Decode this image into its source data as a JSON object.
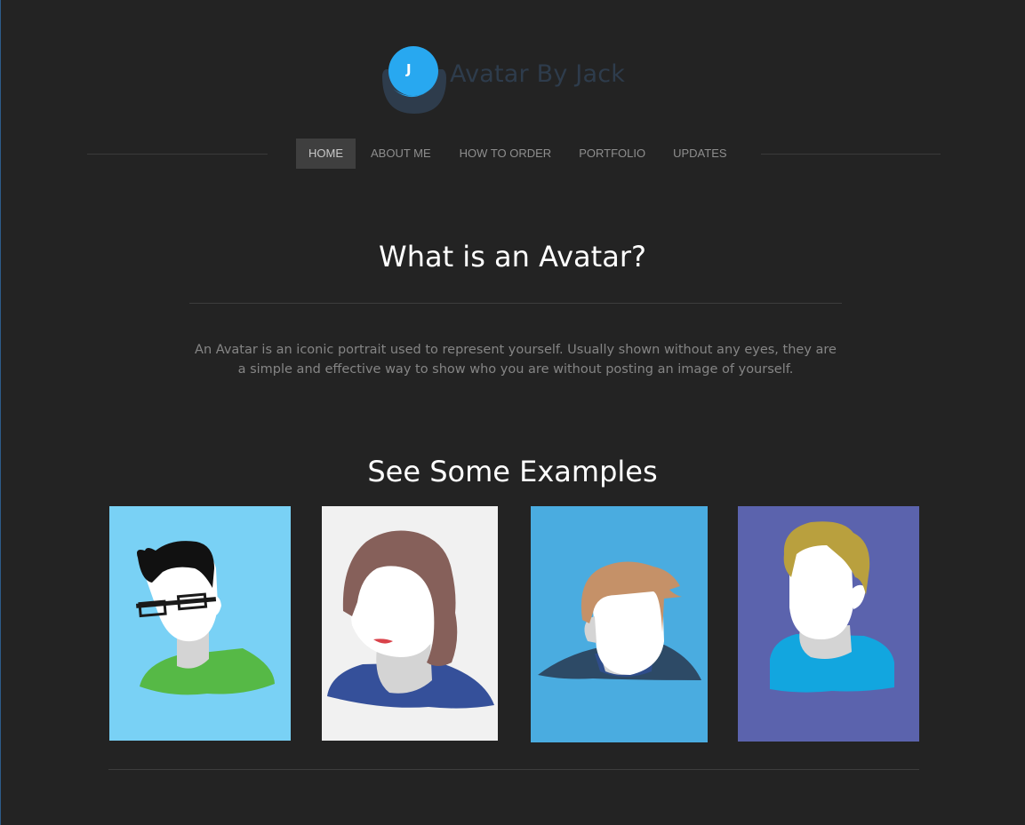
{
  "brand": {
    "logo_letter": "J",
    "name": "Avatar By Jack",
    "logo_color": "#28a8f0"
  },
  "nav": {
    "items": [
      {
        "label": "HOME",
        "active": true
      },
      {
        "label": "ABOUT ME",
        "active": false
      },
      {
        "label": "HOW TO ORDER",
        "active": false
      },
      {
        "label": "PORTFOLIO",
        "active": false
      },
      {
        "label": "UPDATES",
        "active": false
      }
    ]
  },
  "intro": {
    "heading": "What is an Avatar?",
    "body": "An Avatar is an iconic portrait used to represent yourself. Usually shown without any eyes, they are a simple and effective way to show who you are without posting an image of yourself."
  },
  "examples": {
    "heading": "See Some Examples",
    "cards": [
      {
        "name": "avatar-glasses",
        "background": "#79d1f5"
      },
      {
        "name": "avatar-brown-hair",
        "background": "#f1f1f1"
      },
      {
        "name": "avatar-ginger-hair",
        "background": "#4aace0"
      },
      {
        "name": "avatar-blond-hair",
        "background": "#5b63ad"
      }
    ]
  }
}
